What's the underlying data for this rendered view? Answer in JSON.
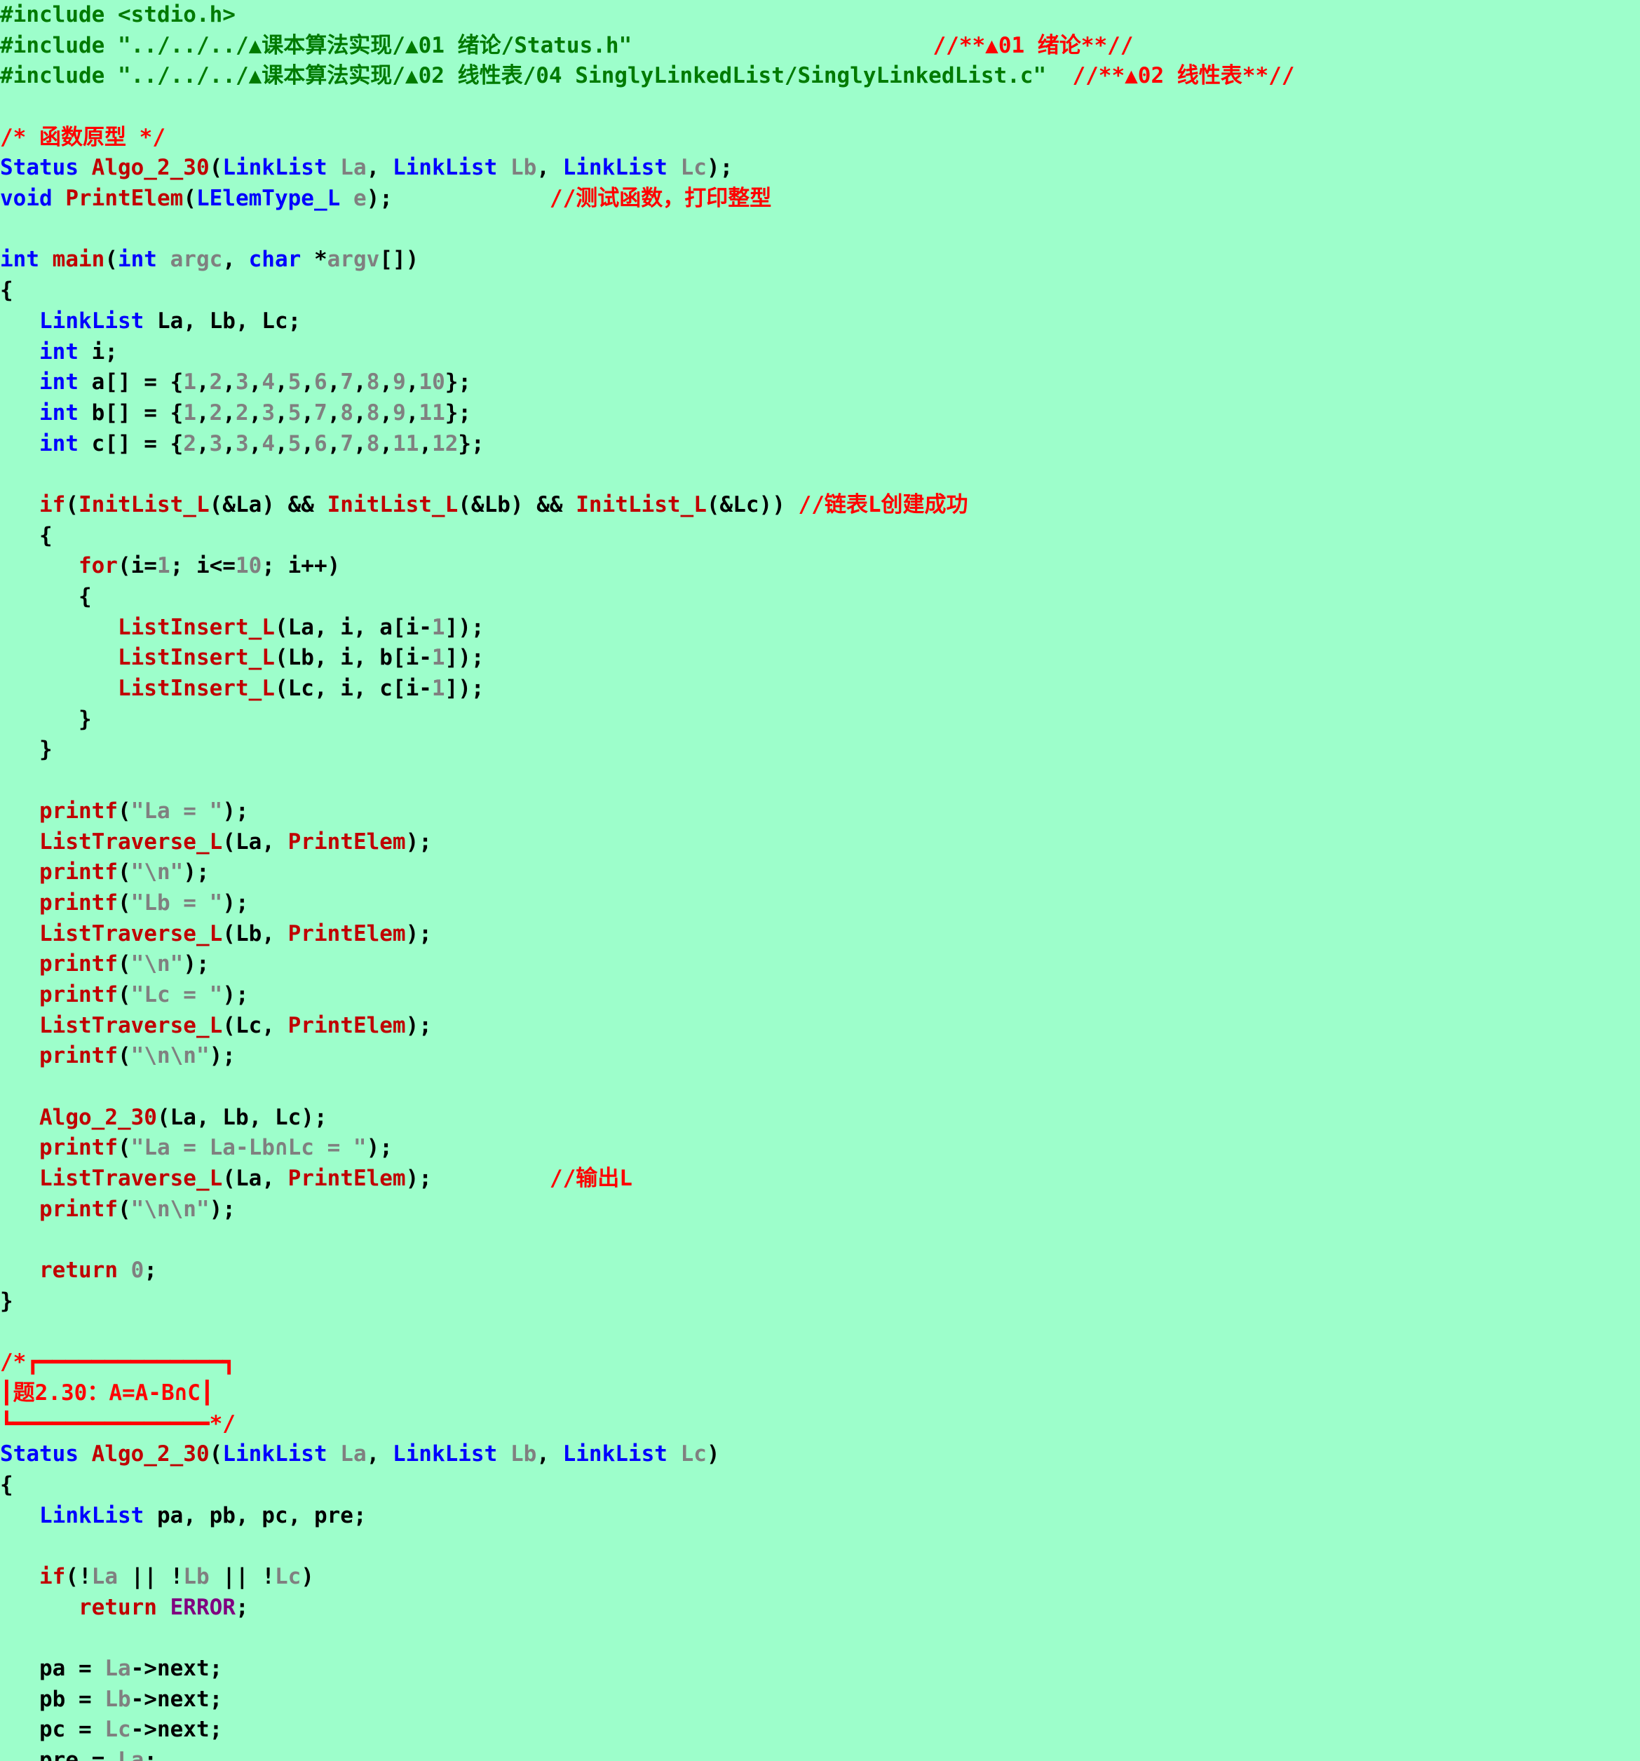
{
  "editor": {
    "background": "#9dfecb",
    "colors": {
      "k-blue": "#0000ff",
      "k-red": "#c00000",
      "c-red": "#ff0000",
      "t-gray": "#808080",
      "t-black": "#000000",
      "t-green": "#007a00",
      "t-purple": "#800080"
    },
    "lines": [
      [
        {
          "t": "#include <stdio.h>",
          "c": "t-green"
        }
      ],
      [
        {
          "t": "#include \"../../../▲课本算法实现/▲01 绪论/Status.h\"",
          "c": "t-green"
        },
        {
          "t": "                       ",
          "c": "t-black"
        },
        {
          "t": "//**▲01 绪论**//",
          "c": "c-red"
        }
      ],
      [
        {
          "t": "#include \"../../../▲课本算法实现/▲02 线性表/04 SinglyLinkedList/SinglyLinkedList.c\"",
          "c": "t-green"
        },
        {
          "t": "  ",
          "c": "t-black"
        },
        {
          "t": "//**▲02 线性表**//",
          "c": "c-red"
        }
      ],
      [],
      [
        {
          "t": "/* 函数原型 */",
          "c": "c-red"
        }
      ],
      [
        {
          "t": "Status ",
          "c": "k-blue"
        },
        {
          "t": "Algo_2_30",
          "c": "k-red"
        },
        {
          "t": "(",
          "c": "t-black"
        },
        {
          "t": "LinkList ",
          "c": "k-blue"
        },
        {
          "t": "La",
          "c": "t-gray"
        },
        {
          "t": ", ",
          "c": "t-black"
        },
        {
          "t": "LinkList ",
          "c": "k-blue"
        },
        {
          "t": "Lb",
          "c": "t-gray"
        },
        {
          "t": ", ",
          "c": "t-black"
        },
        {
          "t": "LinkList ",
          "c": "k-blue"
        },
        {
          "t": "Lc",
          "c": "t-gray"
        },
        {
          "t": ");",
          "c": "t-black"
        }
      ],
      [
        {
          "t": "void ",
          "c": "k-blue"
        },
        {
          "t": "PrintElem",
          "c": "k-red"
        },
        {
          "t": "(",
          "c": "t-black"
        },
        {
          "t": "LElemType_L ",
          "c": "k-blue"
        },
        {
          "t": "e",
          "c": "t-gray"
        },
        {
          "t": ");            ",
          "c": "t-black"
        },
        {
          "t": "//测试函数，打印整型",
          "c": "c-red"
        }
      ],
      [],
      [
        {
          "t": "int ",
          "c": "k-blue"
        },
        {
          "t": "main",
          "c": "k-red"
        },
        {
          "t": "(",
          "c": "t-black"
        },
        {
          "t": "int ",
          "c": "k-blue"
        },
        {
          "t": "argc",
          "c": "t-gray"
        },
        {
          "t": ", ",
          "c": "t-black"
        },
        {
          "t": "char ",
          "c": "k-blue"
        },
        {
          "t": "*",
          "c": "t-black"
        },
        {
          "t": "argv",
          "c": "t-gray"
        },
        {
          "t": "[])",
          "c": "t-black"
        }
      ],
      [
        {
          "t": "{",
          "c": "t-black"
        }
      ],
      [
        {
          "t": "   ",
          "c": "t-black"
        },
        {
          "t": "LinkList ",
          "c": "k-blue"
        },
        {
          "t": "La, Lb, Lc;",
          "c": "t-black"
        }
      ],
      [
        {
          "t": "   ",
          "c": "t-black"
        },
        {
          "t": "int ",
          "c": "k-blue"
        },
        {
          "t": "i;",
          "c": "t-black"
        }
      ],
      [
        {
          "t": "   ",
          "c": "t-black"
        },
        {
          "t": "int ",
          "c": "k-blue"
        },
        {
          "t": "a[] = {",
          "c": "t-black"
        },
        {
          "t": "1",
          "c": "t-gray"
        },
        {
          "t": ",",
          "c": "t-black"
        },
        {
          "t": "2",
          "c": "t-gray"
        },
        {
          "t": ",",
          "c": "t-black"
        },
        {
          "t": "3",
          "c": "t-gray"
        },
        {
          "t": ",",
          "c": "t-black"
        },
        {
          "t": "4",
          "c": "t-gray"
        },
        {
          "t": ",",
          "c": "t-black"
        },
        {
          "t": "5",
          "c": "t-gray"
        },
        {
          "t": ",",
          "c": "t-black"
        },
        {
          "t": "6",
          "c": "t-gray"
        },
        {
          "t": ",",
          "c": "t-black"
        },
        {
          "t": "7",
          "c": "t-gray"
        },
        {
          "t": ",",
          "c": "t-black"
        },
        {
          "t": "8",
          "c": "t-gray"
        },
        {
          "t": ",",
          "c": "t-black"
        },
        {
          "t": "9",
          "c": "t-gray"
        },
        {
          "t": ",",
          "c": "t-black"
        },
        {
          "t": "10",
          "c": "t-gray"
        },
        {
          "t": "};",
          "c": "t-black"
        }
      ],
      [
        {
          "t": "   ",
          "c": "t-black"
        },
        {
          "t": "int ",
          "c": "k-blue"
        },
        {
          "t": "b[] = {",
          "c": "t-black"
        },
        {
          "t": "1",
          "c": "t-gray"
        },
        {
          "t": ",",
          "c": "t-black"
        },
        {
          "t": "2",
          "c": "t-gray"
        },
        {
          "t": ",",
          "c": "t-black"
        },
        {
          "t": "2",
          "c": "t-gray"
        },
        {
          "t": ",",
          "c": "t-black"
        },
        {
          "t": "3",
          "c": "t-gray"
        },
        {
          "t": ",",
          "c": "t-black"
        },
        {
          "t": "5",
          "c": "t-gray"
        },
        {
          "t": ",",
          "c": "t-black"
        },
        {
          "t": "7",
          "c": "t-gray"
        },
        {
          "t": ",",
          "c": "t-black"
        },
        {
          "t": "8",
          "c": "t-gray"
        },
        {
          "t": ",",
          "c": "t-black"
        },
        {
          "t": "8",
          "c": "t-gray"
        },
        {
          "t": ",",
          "c": "t-black"
        },
        {
          "t": "9",
          "c": "t-gray"
        },
        {
          "t": ",",
          "c": "t-black"
        },
        {
          "t": "11",
          "c": "t-gray"
        },
        {
          "t": "};",
          "c": "t-black"
        }
      ],
      [
        {
          "t": "   ",
          "c": "t-black"
        },
        {
          "t": "int ",
          "c": "k-blue"
        },
        {
          "t": "c[] = {",
          "c": "t-black"
        },
        {
          "t": "2",
          "c": "t-gray"
        },
        {
          "t": ",",
          "c": "t-black"
        },
        {
          "t": "3",
          "c": "t-gray"
        },
        {
          "t": ",",
          "c": "t-black"
        },
        {
          "t": "3",
          "c": "t-gray"
        },
        {
          "t": ",",
          "c": "t-black"
        },
        {
          "t": "4",
          "c": "t-gray"
        },
        {
          "t": ",",
          "c": "t-black"
        },
        {
          "t": "5",
          "c": "t-gray"
        },
        {
          "t": ",",
          "c": "t-black"
        },
        {
          "t": "6",
          "c": "t-gray"
        },
        {
          "t": ",",
          "c": "t-black"
        },
        {
          "t": "7",
          "c": "t-gray"
        },
        {
          "t": ",",
          "c": "t-black"
        },
        {
          "t": "8",
          "c": "t-gray"
        },
        {
          "t": ",",
          "c": "t-black"
        },
        {
          "t": "11",
          "c": "t-gray"
        },
        {
          "t": ",",
          "c": "t-black"
        },
        {
          "t": "12",
          "c": "t-gray"
        },
        {
          "t": "};",
          "c": "t-black"
        }
      ],
      [],
      [
        {
          "t": "   ",
          "c": "t-black"
        },
        {
          "t": "if",
          "c": "k-red"
        },
        {
          "t": "(",
          "c": "t-black"
        },
        {
          "t": "InitList_L",
          "c": "k-red"
        },
        {
          "t": "(&La) && ",
          "c": "t-black"
        },
        {
          "t": "InitList_L",
          "c": "k-red"
        },
        {
          "t": "(&Lb) && ",
          "c": "t-black"
        },
        {
          "t": "InitList_L",
          "c": "k-red"
        },
        {
          "t": "(&Lc)) ",
          "c": "t-black"
        },
        {
          "t": "//链表L创建成功",
          "c": "c-red"
        }
      ],
      [
        {
          "t": "   {",
          "c": "t-black"
        }
      ],
      [
        {
          "t": "      ",
          "c": "t-black"
        },
        {
          "t": "for",
          "c": "k-red"
        },
        {
          "t": "(i=",
          "c": "t-black"
        },
        {
          "t": "1",
          "c": "t-gray"
        },
        {
          "t": "; i<=",
          "c": "t-black"
        },
        {
          "t": "10",
          "c": "t-gray"
        },
        {
          "t": "; i++)",
          "c": "t-black"
        }
      ],
      [
        {
          "t": "      {",
          "c": "t-black"
        }
      ],
      [
        {
          "t": "         ",
          "c": "t-black"
        },
        {
          "t": "ListInsert_L",
          "c": "k-red"
        },
        {
          "t": "(La, i, a[i-",
          "c": "t-black"
        },
        {
          "t": "1",
          "c": "t-gray"
        },
        {
          "t": "]);",
          "c": "t-black"
        }
      ],
      [
        {
          "t": "         ",
          "c": "t-black"
        },
        {
          "t": "ListInsert_L",
          "c": "k-red"
        },
        {
          "t": "(Lb, i, b[i-",
          "c": "t-black"
        },
        {
          "t": "1",
          "c": "t-gray"
        },
        {
          "t": "]);",
          "c": "t-black"
        }
      ],
      [
        {
          "t": "         ",
          "c": "t-black"
        },
        {
          "t": "ListInsert_L",
          "c": "k-red"
        },
        {
          "t": "(Lc, i, c[i-",
          "c": "t-black"
        },
        {
          "t": "1",
          "c": "t-gray"
        },
        {
          "t": "]);",
          "c": "t-black"
        }
      ],
      [
        {
          "t": "      }",
          "c": "t-black"
        }
      ],
      [
        {
          "t": "   }",
          "c": "t-black"
        }
      ],
      [],
      [
        {
          "t": "   ",
          "c": "t-black"
        },
        {
          "t": "printf",
          "c": "k-red"
        },
        {
          "t": "(",
          "c": "t-black"
        },
        {
          "t": "\"La = \"",
          "c": "t-gray"
        },
        {
          "t": ");",
          "c": "t-black"
        }
      ],
      [
        {
          "t": "   ",
          "c": "t-black"
        },
        {
          "t": "ListTraverse_L",
          "c": "k-red"
        },
        {
          "t": "(La, ",
          "c": "t-black"
        },
        {
          "t": "PrintElem",
          "c": "k-red"
        },
        {
          "t": ");",
          "c": "t-black"
        }
      ],
      [
        {
          "t": "   ",
          "c": "t-black"
        },
        {
          "t": "printf",
          "c": "k-red"
        },
        {
          "t": "(",
          "c": "t-black"
        },
        {
          "t": "\"\\n\"",
          "c": "t-gray"
        },
        {
          "t": ");",
          "c": "t-black"
        }
      ],
      [
        {
          "t": "   ",
          "c": "t-black"
        },
        {
          "t": "printf",
          "c": "k-red"
        },
        {
          "t": "(",
          "c": "t-black"
        },
        {
          "t": "\"Lb = \"",
          "c": "t-gray"
        },
        {
          "t": ");",
          "c": "t-black"
        }
      ],
      [
        {
          "t": "   ",
          "c": "t-black"
        },
        {
          "t": "ListTraverse_L",
          "c": "k-red"
        },
        {
          "t": "(Lb, ",
          "c": "t-black"
        },
        {
          "t": "PrintElem",
          "c": "k-red"
        },
        {
          "t": ");",
          "c": "t-black"
        }
      ],
      [
        {
          "t": "   ",
          "c": "t-black"
        },
        {
          "t": "printf",
          "c": "k-red"
        },
        {
          "t": "(",
          "c": "t-black"
        },
        {
          "t": "\"\\n\"",
          "c": "t-gray"
        },
        {
          "t": ");",
          "c": "t-black"
        }
      ],
      [
        {
          "t": "   ",
          "c": "t-black"
        },
        {
          "t": "printf",
          "c": "k-red"
        },
        {
          "t": "(",
          "c": "t-black"
        },
        {
          "t": "\"Lc = \"",
          "c": "t-gray"
        },
        {
          "t": ");",
          "c": "t-black"
        }
      ],
      [
        {
          "t": "   ",
          "c": "t-black"
        },
        {
          "t": "ListTraverse_L",
          "c": "k-red"
        },
        {
          "t": "(Lc, ",
          "c": "t-black"
        },
        {
          "t": "PrintElem",
          "c": "k-red"
        },
        {
          "t": ");",
          "c": "t-black"
        }
      ],
      [
        {
          "t": "   ",
          "c": "t-black"
        },
        {
          "t": "printf",
          "c": "k-red"
        },
        {
          "t": "(",
          "c": "t-black"
        },
        {
          "t": "\"\\n\\n\"",
          "c": "t-gray"
        },
        {
          "t": ");",
          "c": "t-black"
        }
      ],
      [],
      [
        {
          "t": "   ",
          "c": "t-black"
        },
        {
          "t": "Algo_2_30",
          "c": "k-red"
        },
        {
          "t": "(La, Lb, Lc);",
          "c": "t-black"
        }
      ],
      [
        {
          "t": "   ",
          "c": "t-black"
        },
        {
          "t": "printf",
          "c": "k-red"
        },
        {
          "t": "(",
          "c": "t-black"
        },
        {
          "t": "\"La = La-Lb∩Lc = \"",
          "c": "t-gray"
        },
        {
          "t": ");",
          "c": "t-black"
        }
      ],
      [
        {
          "t": "   ",
          "c": "t-black"
        },
        {
          "t": "ListTraverse_L",
          "c": "k-red"
        },
        {
          "t": "(La, ",
          "c": "t-black"
        },
        {
          "t": "PrintElem",
          "c": "k-red"
        },
        {
          "t": ");         ",
          "c": "t-black"
        },
        {
          "t": "//输出L",
          "c": "c-red"
        }
      ],
      [
        {
          "t": "   ",
          "c": "t-black"
        },
        {
          "t": "printf",
          "c": "k-red"
        },
        {
          "t": "(",
          "c": "t-black"
        },
        {
          "t": "\"\\n\\n\"",
          "c": "t-gray"
        },
        {
          "t": ");",
          "c": "t-black"
        }
      ],
      [],
      [
        {
          "t": "   ",
          "c": "t-black"
        },
        {
          "t": "return ",
          "c": "k-red"
        },
        {
          "t": "0",
          "c": "t-gray"
        },
        {
          "t": ";",
          "c": "t-black"
        }
      ],
      [
        {
          "t": "}",
          "c": "t-black"
        }
      ],
      [],
      [
        {
          "t": "/*┏━━━━━━━━━━━━━━┓",
          "c": "c-red"
        }
      ],
      [
        {
          "t": "┃题2.30：A=A-B∩C┃",
          "c": "c-red"
        }
      ],
      [
        {
          "t": "┗━━━━━━━━━━━━━━━*/",
          "c": "c-red"
        }
      ],
      [
        {
          "t": "Status ",
          "c": "k-blue"
        },
        {
          "t": "Algo_2_30",
          "c": "k-red"
        },
        {
          "t": "(",
          "c": "t-black"
        },
        {
          "t": "LinkList ",
          "c": "k-blue"
        },
        {
          "t": "La",
          "c": "t-gray"
        },
        {
          "t": ", ",
          "c": "t-black"
        },
        {
          "t": "LinkList ",
          "c": "k-blue"
        },
        {
          "t": "Lb",
          "c": "t-gray"
        },
        {
          "t": ", ",
          "c": "t-black"
        },
        {
          "t": "LinkList ",
          "c": "k-blue"
        },
        {
          "t": "Lc",
          "c": "t-gray"
        },
        {
          "t": ")",
          "c": "t-black"
        }
      ],
      [
        {
          "t": "{",
          "c": "t-black"
        }
      ],
      [
        {
          "t": "   ",
          "c": "t-black"
        },
        {
          "t": "LinkList ",
          "c": "k-blue"
        },
        {
          "t": "pa, pb, pc, pre;",
          "c": "t-black"
        }
      ],
      [],
      [
        {
          "t": "   ",
          "c": "t-black"
        },
        {
          "t": "if",
          "c": "k-red"
        },
        {
          "t": "(!",
          "c": "t-black"
        },
        {
          "t": "La",
          "c": "t-gray"
        },
        {
          "t": " || !",
          "c": "t-black"
        },
        {
          "t": "Lb",
          "c": "t-gray"
        },
        {
          "t": " || !",
          "c": "t-black"
        },
        {
          "t": "Lc",
          "c": "t-gray"
        },
        {
          "t": ")",
          "c": "t-black"
        }
      ],
      [
        {
          "t": "      ",
          "c": "t-black"
        },
        {
          "t": "return ",
          "c": "k-red"
        },
        {
          "t": "ERROR",
          "c": "t-purple"
        },
        {
          "t": ";",
          "c": "t-black"
        }
      ],
      [],
      [
        {
          "t": "   pa = ",
          "c": "t-black"
        },
        {
          "t": "La",
          "c": "t-gray"
        },
        {
          "t": "->next;",
          "c": "t-black"
        }
      ],
      [
        {
          "t": "   pb = ",
          "c": "t-black"
        },
        {
          "t": "Lb",
          "c": "t-gray"
        },
        {
          "t": "->next;",
          "c": "t-black"
        }
      ],
      [
        {
          "t": "   pc = ",
          "c": "t-black"
        },
        {
          "t": "Lc",
          "c": "t-gray"
        },
        {
          "t": "->next;",
          "c": "t-black"
        }
      ],
      [
        {
          "t": "   pre = ",
          "c": "t-black"
        },
        {
          "t": "La",
          "c": "t-gray"
        },
        {
          "t": ";",
          "c": "t-black"
        }
      ]
    ]
  }
}
